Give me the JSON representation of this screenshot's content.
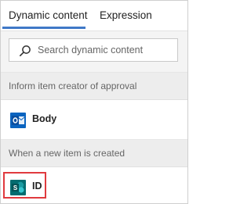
{
  "tabs": {
    "dynamic_content": "Dynamic content",
    "expression": "Expression"
  },
  "search": {
    "placeholder": "Search dynamic content"
  },
  "sections": [
    {
      "header": "Inform item creator of approval",
      "items": [
        {
          "label": "Body",
          "icon": "outlook-icon"
        }
      ]
    },
    {
      "header": "When a new item is created",
      "items": [
        {
          "label": "ID",
          "icon": "sharepoint-icon"
        }
      ]
    }
  ],
  "colors": {
    "tab_accent": "#3f78c7",
    "highlight": "#e03a3e",
    "outlook_blue": "#0a64c0",
    "sharepoint_teal": "#036c70"
  }
}
